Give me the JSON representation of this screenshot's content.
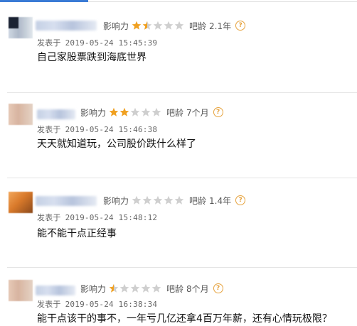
{
  "colors": {
    "accent": "#3a7bd5",
    "star_on": "#f0a020",
    "star_off": "#cfcfcf",
    "help": "#e6a23c"
  },
  "labels": {
    "influence": "影响力",
    "bar_age": "吧龄",
    "posted_at": "发表于",
    "help_icon": "?"
  },
  "posts": [
    {
      "rating": 1.5,
      "bar_age": "2.1年",
      "posted_at": "2019-05-24 15:45:39",
      "content": "自己家股票跌到海底世界"
    },
    {
      "rating": 2,
      "bar_age": "7个月",
      "posted_at": "2019-05-24 15:46:38",
      "content": "天天就知道玩，公司股价跌什么样了"
    },
    {
      "rating": 0,
      "bar_age": "1.4年",
      "posted_at": "2019-05-24 15:48:12",
      "content": "能不能干点正经事"
    },
    {
      "rating": 0.5,
      "bar_age": "8个月",
      "posted_at": "2019-05-24 16:38:34",
      "content": "能干点该干的事不，一年亏几亿还拿4百万年薪，还有心情玩极限？"
    }
  ]
}
